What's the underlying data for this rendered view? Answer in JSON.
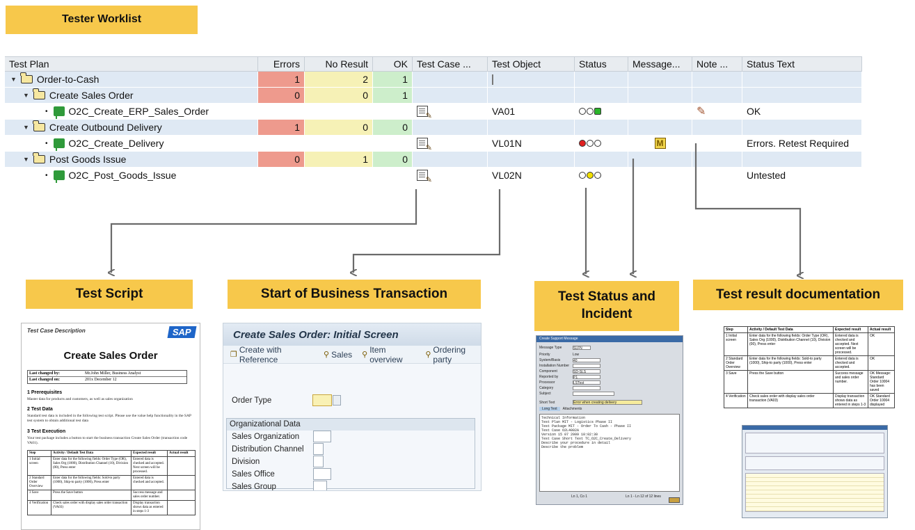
{
  "header": {
    "title": "Tester Worklist"
  },
  "grid": {
    "columns": [
      "Test Plan",
      "Errors",
      "No Result",
      "OK",
      "Test Case ...",
      "Test Object",
      "Status",
      "Message...",
      "Note ...",
      "Status Text"
    ],
    "rows": [
      {
        "name": "Order-to-Cash",
        "errors": "1",
        "no_result": "2",
        "ok": "1",
        "test_object": "",
        "status_text": ""
      },
      {
        "name": "Create Sales Order",
        "errors": "0",
        "no_result": "0",
        "ok": "1",
        "test_object": "",
        "status_text": ""
      },
      {
        "name": "O2C_Create_ERP_Sales_Order",
        "errors": "",
        "no_result": "",
        "ok": "",
        "test_object": "VA01",
        "status_text": "OK"
      },
      {
        "name": "Create Outbound Delivery",
        "errors": "1",
        "no_result": "0",
        "ok": "0",
        "test_object": "",
        "status_text": ""
      },
      {
        "name": "O2C_Create_Delivery",
        "errors": "",
        "no_result": "",
        "ok": "",
        "test_object": "VL01N",
        "status_text": "Errors. Retest Required"
      },
      {
        "name": "Post Goods Issue",
        "errors": "0",
        "no_result": "1",
        "ok": "0",
        "test_object": "",
        "status_text": ""
      },
      {
        "name": "O2C_Post_Goods_Issue",
        "errors": "",
        "no_result": "",
        "ok": "",
        "test_object": "VL02N",
        "status_text": "Untested"
      }
    ]
  },
  "callouts": {
    "test_script": "Test Script",
    "business_transaction": "Start of Business Transaction",
    "status_incident": "Test Status and Incident",
    "result_doc": "Test result documentation"
  },
  "test_script": {
    "header": "Test Case Description",
    "logo": "SAP",
    "title": "Create Sales Order",
    "last_changed_by_label": "Last changed by:",
    "last_changed_by": "Mr.John Miller, Business Analyst",
    "last_changed_on_label": "Last changed on:",
    "last_changed_on": "201x December 12",
    "s1": "1   Prerequisites",
    "s1_text": "Master data for products and customers, as well as sales organization",
    "s2": "2   Test Data",
    "s2_text": "Standard test data is included in the following test script. Please use the value help functionality in the SAP test system to obtain additional test data",
    "s3": "3   Test Execution",
    "s3_text": "Your test package includes a button to start the business transaction Create Sales Order (transaction code VA01).",
    "table_head": [
      "Step",
      "Activity / Default Test Data",
      "Expected result",
      "Actual result"
    ],
    "table_rows": [
      [
        "1 Initial screen",
        "Enter data for the following fields: Order Type (OR), Sales Org (1000), Distribution Channel (10), Division (00), Press enter",
        "Entered data is checked and accepted. Next screen will be processed.",
        ""
      ],
      [
        "2 Standard Order Overview",
        "Enter data for the following fields: Sold-to party (1000), Ship-to party (1000), Press enter",
        "Entered data is checked and accepted.",
        ""
      ],
      [
        "3 Save",
        "Press the Save button",
        "Success message and sales order number.",
        ""
      ],
      [
        "4 Verification",
        "Check sales order with display sales order transaction (VA03)",
        "Display transaction shows data as entered in steps 1-3",
        ""
      ]
    ]
  },
  "sap_screen": {
    "title": "Create Sales Order: Initial Screen",
    "toolbar": [
      "Create with Reference",
      "Sales",
      "Item overview",
      "Ordering party"
    ],
    "order_type": "Order Type",
    "group_title": "Organizational Data",
    "fields": [
      "Sales Organization",
      "Distribution Channel",
      "Division",
      "Sales Office",
      "Sales Group"
    ]
  },
  "incident": {
    "window_title": "Create Support Message",
    "fields": [
      {
        "label": "Message Type",
        "value": "SLFN"
      },
      {
        "label": "Priority",
        "value": "Low"
      },
      {
        "label": "System/Basis",
        "value": "40"
      },
      {
        "label": "Installation Number",
        "value": ""
      },
      {
        "label": "Component",
        "value": "SD-SLS"
      },
      {
        "label": "Reported by",
        "value": "P1"
      },
      {
        "label": "Processor",
        "value": "LSTest"
      },
      {
        "label": "Category",
        "value": ""
      },
      {
        "label": "Subject",
        "value": ""
      }
    ],
    "short_text_label": "Short Text",
    "short_text": "Error when creating delivery",
    "tabs": [
      "Long Text",
      "Attachments"
    ],
    "long_text": [
      "Technical Information",
      "Test Plan        MIT - Logistics Phase II",
      "Test Package     MIT - Order To Cash - Phase II",
      "Test Case        O2L4002A",
      "                 Version 15 07 2009 10:02:30",
      "Test Case Short Text TC_O2C_Create_Delivery",
      "",
      "Describe your procedure in detail",
      "",
      "",
      "Describe the problem"
    ],
    "footer_left": "Ln 1, Co 1",
    "footer_right": "Ln 1 - Ln 12 of 12 lines"
  },
  "results": {
    "head": [
      "Step",
      "Activity / Default Test Data",
      "Expected result",
      "Actual result"
    ],
    "rows": [
      [
        "1 Initial screen",
        "Enter data for the following fields: Order Type (OR), Sales Org (1000), Distribution Channel (10), Division (00), Press enter",
        "Entered data is checked and accepted. Next screen will be processed.",
        "OK"
      ],
      [
        "2 Standard Order Overview",
        "Enter data for the following fields: Sold-to party (1000), Ship-to party (1000), Press enter",
        "Entered data is checked and accepted.",
        "OK"
      ],
      [
        "3 Save",
        "Press the Save button",
        "Success message and sales order number.",
        "OK Message: Standard Order 10004 has been saved"
      ],
      [
        "4 Verification",
        "Check sales order with display sales order transaction (VA03)",
        "Display transaction shows data as entered in steps 1-3",
        "OK Standard Order 10004 displayed"
      ]
    ]
  },
  "colors": {
    "callout": "#f7c84b",
    "errors": "#ee9a8d",
    "no_result": "#f6f1b6",
    "ok": "#cdeecb",
    "row_alt": "#dfe9f4",
    "connector": "#6a6a6a"
  }
}
